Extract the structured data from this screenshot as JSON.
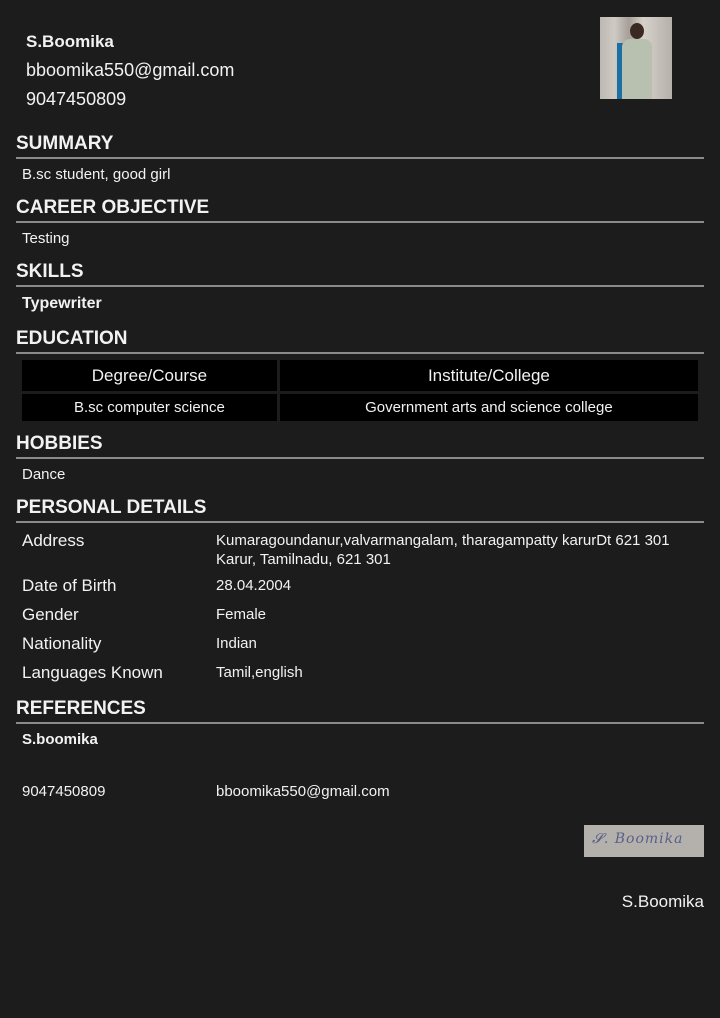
{
  "header": {
    "name": "S.Boomika",
    "email": "bboomika550@gmail.com",
    "phone": "9047450809"
  },
  "summary": {
    "title": "SUMMARY",
    "text": "B.sc student, good girl"
  },
  "career": {
    "title": "CAREER OBJECTIVE",
    "text": "Testing"
  },
  "skills": {
    "title": "SKILLS",
    "items": [
      "Typewriter"
    ]
  },
  "education": {
    "title": "EDUCATION",
    "columns": [
      "Degree/Course",
      "Institute/College"
    ],
    "rows": [
      [
        "B.sc computer science",
        "Government  arts and science college"
      ]
    ]
  },
  "hobbies": {
    "title": "HOBBIES",
    "text": "Dance"
  },
  "personal": {
    "title": "PERSONAL DETAILS",
    "rows": [
      {
        "label": "Address",
        "value": "Kumaragoundanur,valvarmangalam, tharagampatty karurDt 621 301",
        "value2": "Karur, Tamilnadu, 621 301"
      },
      {
        "label": "Date of Birth",
        "value": "28.04.2004"
      },
      {
        "label": "Gender",
        "value": "Female"
      },
      {
        "label": "Nationality",
        "value": "Indian"
      },
      {
        "label": "Languages Known",
        "value": "Tamil,english"
      }
    ]
  },
  "references": {
    "title": "REFERENCES",
    "name": "S.boomika",
    "phone": "9047450809",
    "email": "bboomika550@gmail.com"
  },
  "signature": {
    "image_text": "S. Boomika",
    "name": "S.Boomika"
  }
}
